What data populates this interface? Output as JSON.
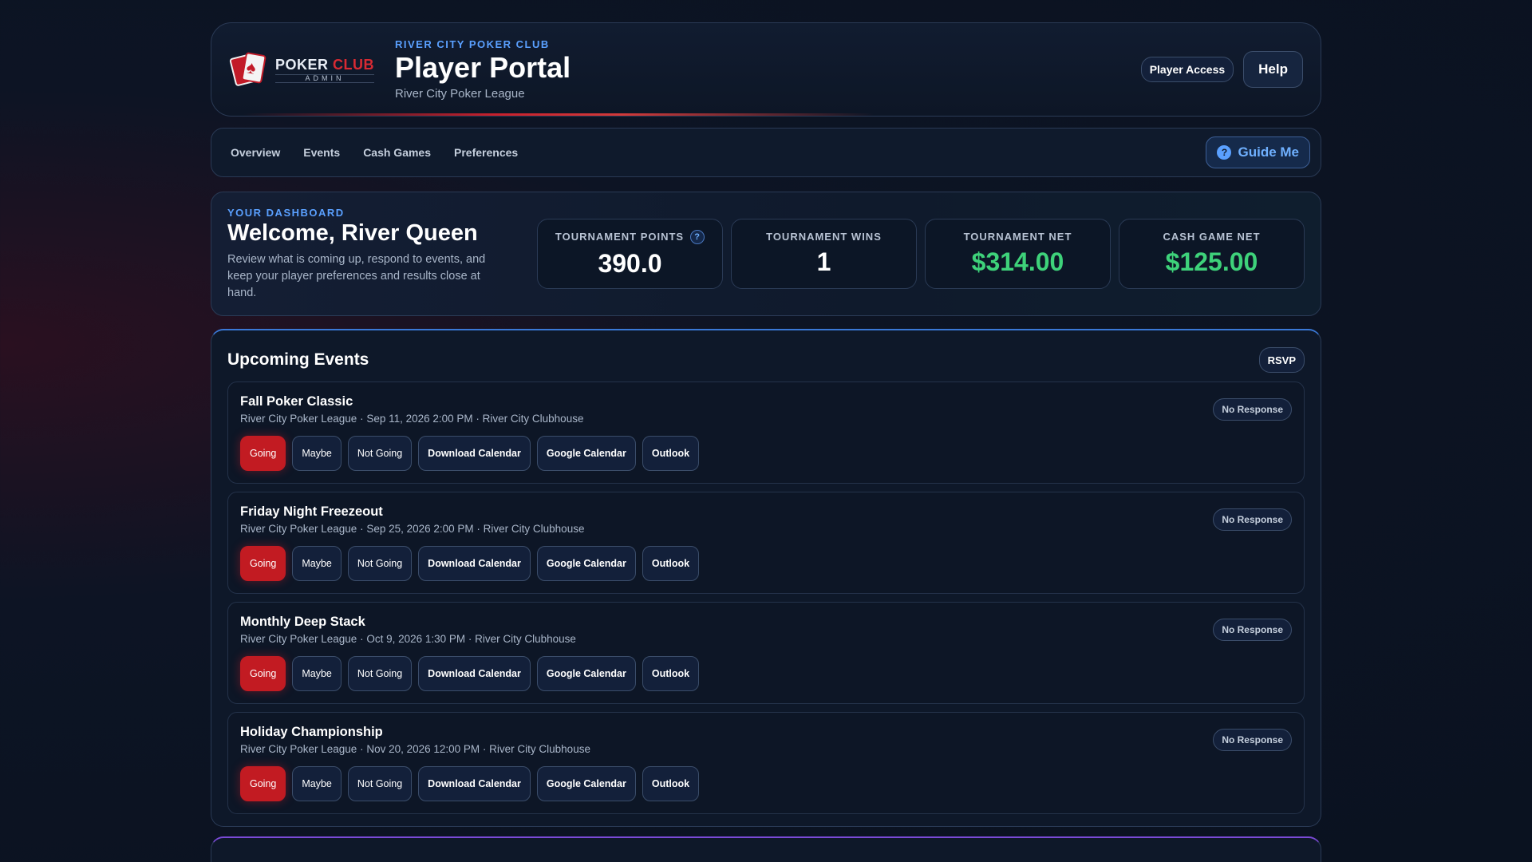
{
  "header": {
    "logo_primary": "POKER",
    "logo_accent": "CLUB",
    "logo_sub": "ADMIN",
    "eyebrow": "RIVER CITY POKER CLUB",
    "title": "Player Portal",
    "subtitle": "River City Poker League",
    "player_access_label": "Player Access",
    "help_label": "Help"
  },
  "nav": {
    "items": [
      {
        "label": "Overview"
      },
      {
        "label": "Events"
      },
      {
        "label": "Cash Games"
      },
      {
        "label": "Preferences"
      }
    ],
    "guide_label": "Guide Me",
    "guide_icon": "question-circle-icon"
  },
  "dashboard": {
    "eyebrow": "YOUR DASHBOARD",
    "title": "Welcome, River Queen",
    "description": "Review what is coming up, respond to events, and keep your player preferences and results close at hand.",
    "stats": [
      {
        "label": "TOURNAMENT POINTS",
        "value": "390.0",
        "has_help": true,
        "color": "#ffffff"
      },
      {
        "label": "TOURNAMENT WINS",
        "value": "1",
        "has_help": false,
        "color": "#ffffff"
      },
      {
        "label": "TOURNAMENT NET",
        "value": "$314.00",
        "has_help": false,
        "color": "#3ed27a"
      },
      {
        "label": "CASH GAME NET",
        "value": "$125.00",
        "has_help": false,
        "color": "#3ed27a"
      }
    ]
  },
  "events": {
    "title": "Upcoming Events",
    "rsvp_label": "RSVP",
    "button_labels": {
      "going": "Going",
      "maybe": "Maybe",
      "not_going": "Not Going",
      "download": "Download Calendar",
      "google": "Google Calendar",
      "outlook": "Outlook"
    },
    "items": [
      {
        "name": "Fall Poker Classic",
        "meta": "River City Poker League · Sep 11, 2026 2:00 PM · River City Clubhouse",
        "status": "No Response"
      },
      {
        "name": "Friday Night Freezeout",
        "meta": "River City Poker League · Sep 25, 2026 2:00 PM · River City Clubhouse",
        "status": "No Response"
      },
      {
        "name": "Monthly Deep Stack",
        "meta": "River City Poker League · Oct 9, 2026 1:30 PM · River City Clubhouse",
        "status": "No Response"
      },
      {
        "name": "Holiday Championship",
        "meta": "River City Poker League · Nov 20, 2026 12:00 PM · River City Clubhouse",
        "status": "No Response"
      }
    ]
  },
  "colors": {
    "accent_blue": "#5aa0ff",
    "going_red": "#c21b22",
    "positive_green": "#3ed27a"
  }
}
